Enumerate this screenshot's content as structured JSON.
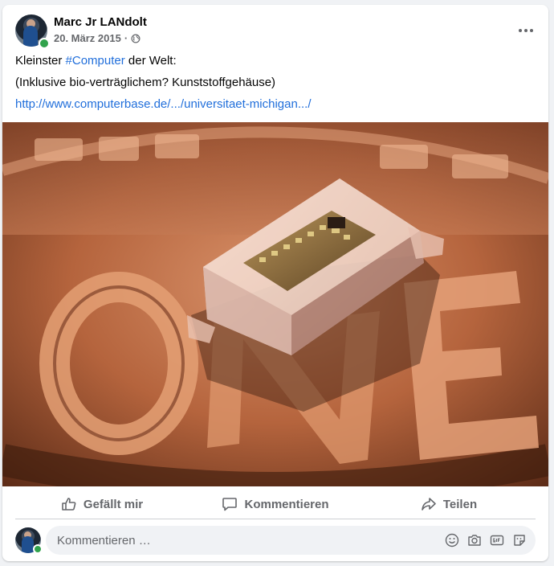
{
  "post": {
    "author": "Marc Jr LANdolt",
    "date": "20. März 2015",
    "separator": "·",
    "privacy_icon": "globe-icon",
    "text_before_hashtag": "Kleinster ",
    "hashtag": "#Computer",
    "text_after_hashtag": " der Welt:",
    "line2": "(Inklusive bio-verträglichem? Kunststoffgehäuse)",
    "link": "http://www.computerbase.de/.../universitaet-michigan.../"
  },
  "actions": {
    "like": "Gefällt mir",
    "comment": "Kommentieren",
    "share": "Teilen"
  },
  "comment": {
    "placeholder": "Kommentieren …"
  },
  "colors": {
    "accent": "#216fdb",
    "online": "#31a24c",
    "secondary_text": "#65676b"
  }
}
